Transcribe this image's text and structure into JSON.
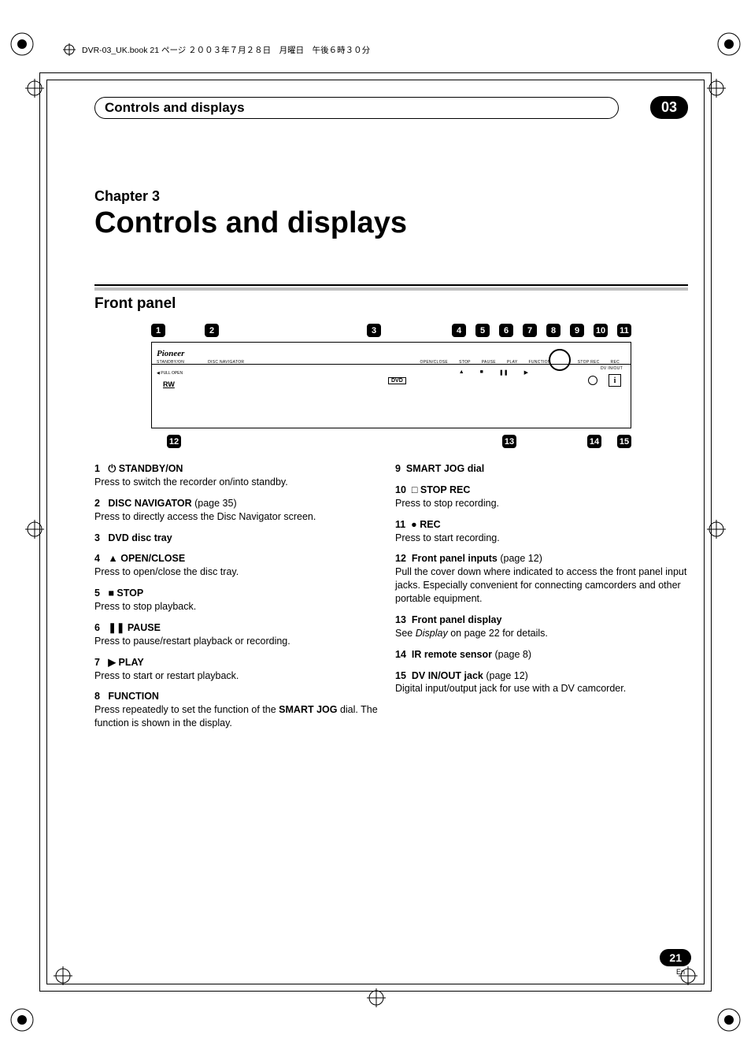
{
  "bookline": "DVR-03_UK.book 21 ページ ２００３年７月２８日　月曜日　午後６時３０分",
  "header": {
    "section": "Controls and displays",
    "chapter_num": "03"
  },
  "chapter": {
    "label": "Chapter 3",
    "title": "Controls and displays"
  },
  "subhead": "Front panel",
  "callouts_top": [
    "1",
    "2",
    "3",
    "4",
    "5",
    "6",
    "7",
    "8",
    "9",
    "10",
    "11"
  ],
  "callouts_bottom": [
    "12",
    "13",
    "14",
    "15"
  ],
  "diagram_labels": {
    "brand": "Pioneer",
    "standby": "STANDBY/ON",
    "discnav": "DISC NAVIGATOR",
    "openclose": "OPEN/CLOSE",
    "stop": "STOP",
    "pause": "PAUSE",
    "play": "PLAY",
    "function": "FUNCTION",
    "stoprec": "STOP REC",
    "rec": "REC",
    "pull": "◀ PULL  OPEN",
    "rw": "RW",
    "dvd": "DVD",
    "dvinout": "DV IN/OUT",
    "i": "i"
  },
  "icons": {
    "power": "⏻",
    "eject": "▲",
    "stop_sq": "■",
    "pause_bars": "❚❚",
    "play_tri": "▶",
    "stoprec_sq": "□",
    "rec_dot": "●"
  },
  "left_items": [
    {
      "num": "1",
      "sym": "⏻",
      "title": "STANDBY/ON",
      "ref": "",
      "desc": "Press to switch the recorder on/into standby."
    },
    {
      "num": "2",
      "sym": "",
      "title": "DISC NAVIGATOR",
      "ref": " (page 35)",
      "desc": "Press to directly access the Disc Navigator screen."
    },
    {
      "num": "3",
      "sym": "",
      "title": "DVD disc tray",
      "ref": "",
      "desc": ""
    },
    {
      "num": "4",
      "sym": "▲",
      "title": "OPEN/CLOSE",
      "ref": "",
      "desc": "Press to open/close the disc tray."
    },
    {
      "num": "5",
      "sym": "■",
      "title": "STOP",
      "ref": "",
      "desc": "Press to stop playback."
    },
    {
      "num": "6",
      "sym": "❚❚",
      "title": "PAUSE",
      "ref": "",
      "desc": "Press to pause/restart playback or recording."
    },
    {
      "num": "7",
      "sym": "▶",
      "title": "PLAY",
      "ref": "",
      "desc": "Press to start or restart playback."
    }
  ],
  "left_item8": {
    "num": "8",
    "title": "FUNCTION",
    "desc_pre": "Press repeatedly to set the function of the ",
    "desc_bold": "SMART JOG",
    "desc_post": " dial. The function is shown in the display."
  },
  "right_items": [
    {
      "num": "9",
      "sym": "",
      "title": "SMART JOG dial",
      "ref": "",
      "desc": ""
    },
    {
      "num": "10",
      "sym": "□",
      "title": "STOP REC",
      "ref": "",
      "desc": "Press to stop recording."
    },
    {
      "num": "11",
      "sym": "●",
      "title": "REC",
      "ref": "",
      "desc": "Press to start recording."
    },
    {
      "num": "12",
      "sym": "",
      "title": "Front panel inputs",
      "ref": " (page 12)",
      "desc": "Pull the cover down where indicated to access the front panel input jacks. Especially convenient for connecting camcorders and other portable equipment."
    }
  ],
  "right_item13": {
    "num": "13",
    "title": "Front panel display",
    "desc_pre": "See ",
    "desc_italic": "Display",
    "desc_post": " on page 22 for details."
  },
  "right_item14": {
    "num": "14",
    "title": "IR remote sensor",
    "ref": " (page 8)",
    "desc": ""
  },
  "right_item15": {
    "num": "15",
    "title": "DV IN/OUT jack",
    "ref": " (page 12)",
    "desc": "Digital input/output jack for use with a DV camcorder."
  },
  "page": {
    "num": "21",
    "lang": "En"
  }
}
